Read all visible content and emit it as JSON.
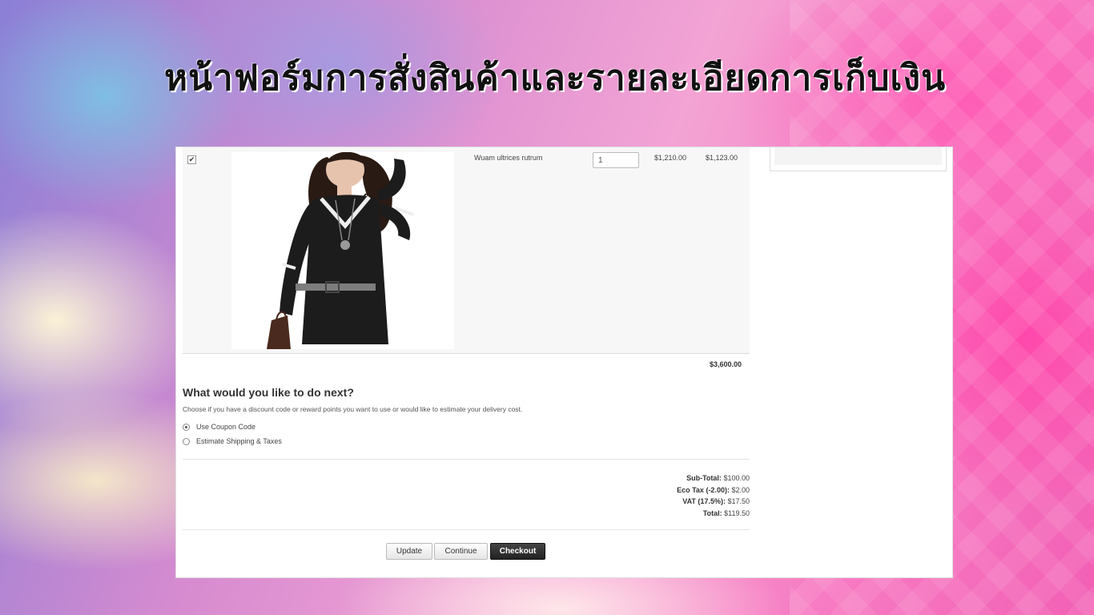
{
  "slide": {
    "title": "หน้าฟอร์มการสั่งสินค้าและรายละเอียดการเก็บเงิน"
  },
  "cart": {
    "item": {
      "selected": true,
      "name": "Wuam ultrices rutrum",
      "quantity": "1",
      "unit_price": "$1,210.00",
      "total": "$1,123.00"
    },
    "grand_total": "$3,600.00"
  },
  "next": {
    "heading": "What would you like to do next?",
    "description": "Choose if you have a discount code or reward points you want to use or would like to estimate your delivery cost.",
    "options": [
      {
        "label": "Use Coupon Code",
        "selected": true
      },
      {
        "label": "Estimate Shipping & Taxes",
        "selected": false
      }
    ]
  },
  "totals": {
    "subtotal_label": "Sub-Total:",
    "subtotal_value": "$100.00",
    "ecotax_label": "Eco Tax (-2.00):",
    "ecotax_value": "$2.00",
    "vat_label": "VAT (17.5%):",
    "vat_value": "$17.50",
    "total_label": "Total:",
    "total_value": "$119.50"
  },
  "buttons": {
    "update": "Update",
    "continue": "Continue",
    "checkout": "Checkout"
  }
}
